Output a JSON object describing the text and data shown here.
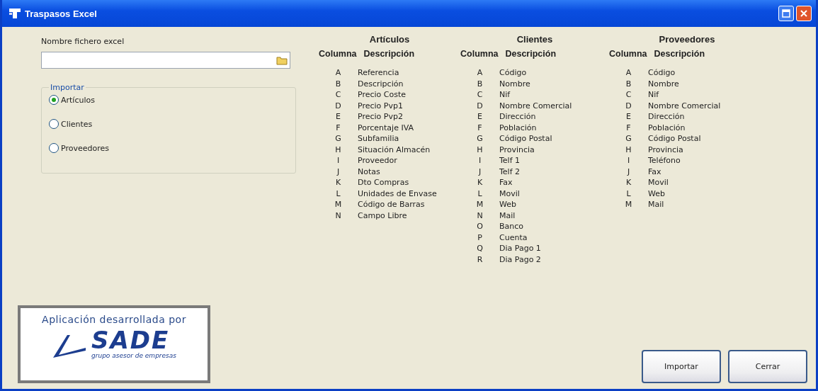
{
  "window": {
    "title": "Traspasos Excel"
  },
  "file": {
    "label": "Nombre fichero excel"
  },
  "import_group": {
    "title": "Importar",
    "options": [
      {
        "label": "Artículos",
        "selected": true
      },
      {
        "label": "Clientes",
        "selected": false
      },
      {
        "label": "Proveedores",
        "selected": false
      }
    ]
  },
  "tables": [
    {
      "title": "Artículos",
      "columns": [
        "Columna",
        "Descripción"
      ],
      "rows": [
        [
          "A",
          "Referencia"
        ],
        [
          "B",
          "Descripción"
        ],
        [
          "C",
          "Precio Coste"
        ],
        [
          "D",
          "Precio Pvp1"
        ],
        [
          "E",
          "Precio Pvp2"
        ],
        [
          "F",
          "Porcentaje IVA"
        ],
        [
          "G",
          "Subfamilia"
        ],
        [
          "H",
          "Situación Almacén"
        ],
        [
          "I",
          "Proveedor"
        ],
        [
          "J",
          "Notas"
        ],
        [
          "K",
          "Dto Compras"
        ],
        [
          "L",
          "Unidades de Envase"
        ],
        [
          "M",
          "Código de Barras"
        ],
        [
          "N",
          "Campo Libre"
        ]
      ]
    },
    {
      "title": "Clientes",
      "columns": [
        "Columna",
        "Descripción"
      ],
      "rows": [
        [
          "A",
          "Código"
        ],
        [
          "B",
          "Nombre"
        ],
        [
          "C",
          "Nif"
        ],
        [
          "D",
          "Nombre Comercial"
        ],
        [
          "E",
          "Dirección"
        ],
        [
          "F",
          "Población"
        ],
        [
          "G",
          "Código Postal"
        ],
        [
          "H",
          "Provincia"
        ],
        [
          "I",
          "Telf 1"
        ],
        [
          "J",
          "Telf 2"
        ],
        [
          "K",
          "Fax"
        ],
        [
          "L",
          "Movil"
        ],
        [
          "M",
          "Web"
        ],
        [
          "N",
          "Mail"
        ],
        [
          "O",
          "Banco"
        ],
        [
          "P",
          "Cuenta"
        ],
        [
          "Q",
          "Dia Pago 1"
        ],
        [
          "R",
          "Dia Pago 2"
        ]
      ]
    },
    {
      "title": "Proveedores",
      "columns": [
        "Columna",
        "Descripción"
      ],
      "rows": [
        [
          "A",
          "Código"
        ],
        [
          "B",
          "Nombre"
        ],
        [
          "C",
          "Nif"
        ],
        [
          "D",
          "Nombre Comercial"
        ],
        [
          "E",
          "Dirección"
        ],
        [
          "F",
          "Población"
        ],
        [
          "G",
          "Código Postal"
        ],
        [
          "H",
          "Provincia"
        ],
        [
          "I",
          "Teléfono"
        ],
        [
          "J",
          "Fax"
        ],
        [
          "K",
          "Movil"
        ],
        [
          "L",
          "Web"
        ],
        [
          "M",
          "Mail"
        ]
      ]
    }
  ],
  "logo": {
    "caption": "Aplicación desarrollada por",
    "name": "SADE",
    "tagline": "grupo asesor de empresas"
  },
  "buttons": [
    "Importar",
    "Cerrar"
  ]
}
